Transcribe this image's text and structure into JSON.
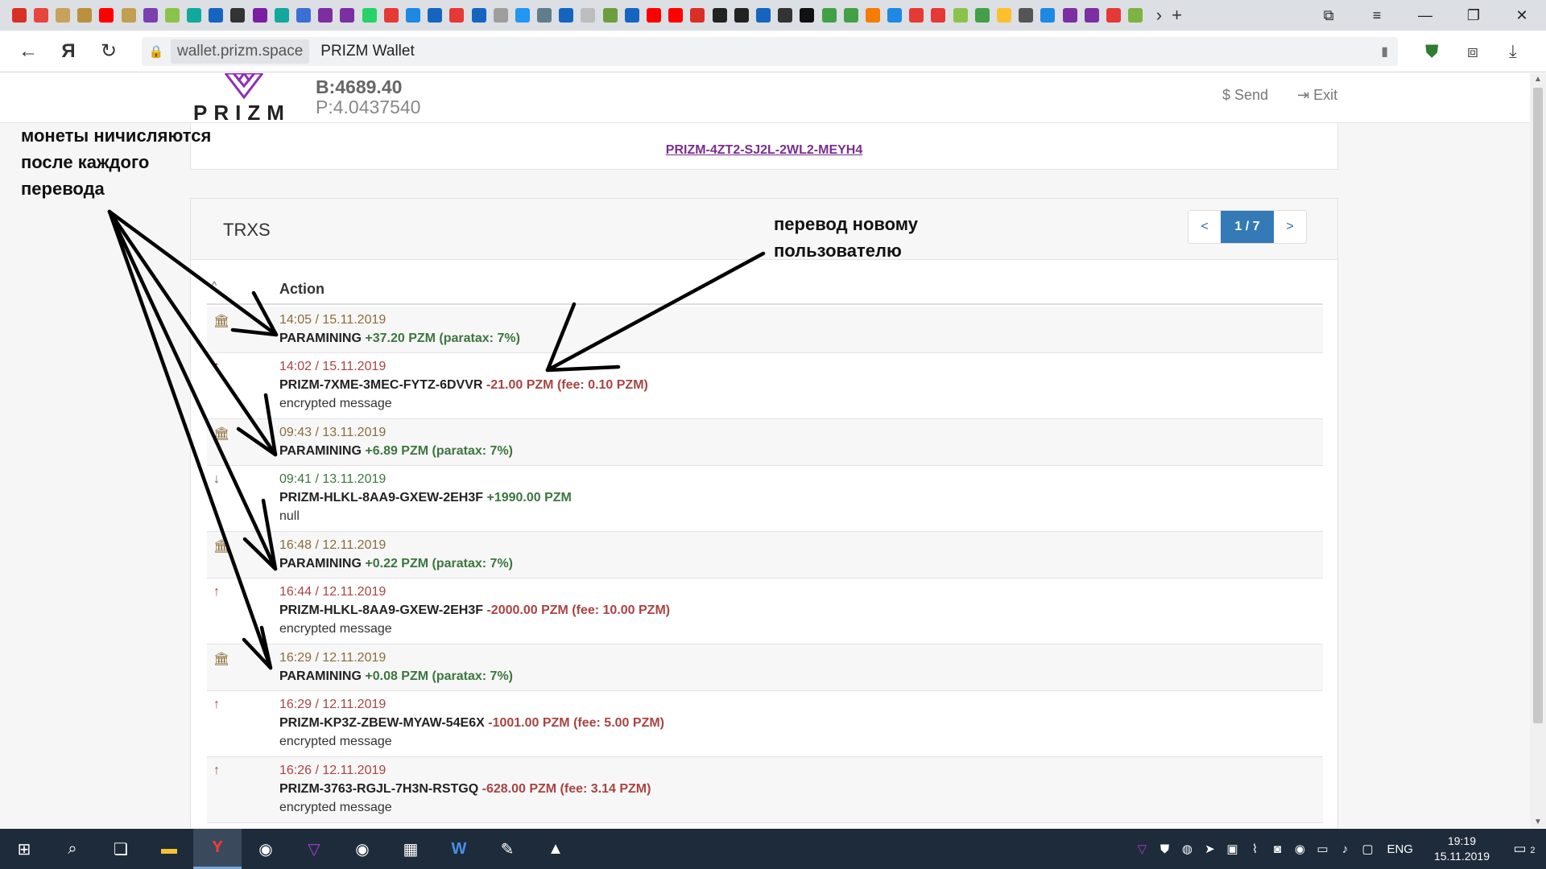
{
  "browser": {
    "domain": "wallet.prizm.space",
    "page_title": "PRIZM Wallet",
    "tab_icon_colors": [
      "#d93025",
      "#e8453c",
      "#c8a25c",
      "#b9913f",
      "#ff0000",
      "#c0a050",
      "#7b3fb0",
      "#8bc34a",
      "#13a89e",
      "#1565c0",
      "#333333",
      "#7b1fa2",
      "#13a89e",
      "#3b6fd6",
      "#7b2fa0",
      "#7b2fa0",
      "#25d366",
      "#e53935",
      "#1e88e5",
      "#1565c0",
      "#e53935",
      "#1565c0",
      "#9e9e9e",
      "#2196f3",
      "#607d8b",
      "#1565c0",
      "#bdbdbd",
      "#6d9e3d",
      "#1565c0",
      "#ff0000",
      "#ff0000",
      "#d93025",
      "#222222",
      "#222222",
      "#1565c0",
      "#333333",
      "#111111",
      "#43a047",
      "#43a047",
      "#f57c00",
      "#1e88e5",
      "#e53935",
      "#e53935",
      "#8bc34a",
      "#43a047",
      "#fbc02d",
      "#555555",
      "#1e88e5",
      "#7b2fa0",
      "#7b2fa0",
      "#e53935",
      "#7cb342"
    ]
  },
  "header": {
    "logo_text": "PRIZM",
    "balance_b": "B:4689.40",
    "balance_p": "P:4.0437540",
    "send_label": "Send",
    "exit_label": "Exit"
  },
  "account": {
    "address": "PRIZM-4ZT2-SJ2L-2WL2-MEYH4"
  },
  "trx": {
    "title": "TRXS",
    "pager": {
      "prev": "<",
      "current": "1 / 7",
      "next": ">"
    },
    "column": "Action",
    "rows": [
      {
        "icon": "bank",
        "date": "14:05 / 15.11.2019",
        "party": "PARAMINING",
        "amount": "+37.20 PZM (paratax: 7%)",
        "sign": "g",
        "msg": ""
      },
      {
        "icon": "up",
        "date": "14:02 / 15.11.2019",
        "party": "PRIZM-7XME-3MEC-FYTZ-6DVVR",
        "amount": "-21.00 PZM (fee: 0.10 PZM)",
        "sign": "r",
        "msg": "encrypted message"
      },
      {
        "icon": "bank",
        "date": "09:43 / 13.11.2019",
        "party": "PARAMINING",
        "amount": "+6.89 PZM (paratax: 7%)",
        "sign": "g",
        "msg": ""
      },
      {
        "icon": "down",
        "date": "09:41 / 13.11.2019",
        "party": "PRIZM-HLKL-8AA9-GXEW-2EH3F",
        "amount": "+1990.00 PZM",
        "sign": "g",
        "msg": "null"
      },
      {
        "icon": "bank",
        "date": "16:48 / 12.11.2019",
        "party": "PARAMINING",
        "amount": "+0.22 PZM (paratax: 7%)",
        "sign": "g",
        "msg": ""
      },
      {
        "icon": "up",
        "date": "16:44 / 12.11.2019",
        "party": "PRIZM-HLKL-8AA9-GXEW-2EH3F",
        "amount": "-2000.00 PZM (fee: 10.00 PZM)",
        "sign": "r",
        "msg": "encrypted message"
      },
      {
        "icon": "bank",
        "date": "16:29 / 12.11.2019",
        "party": "PARAMINING",
        "amount": "+0.08 PZM (paratax: 7%)",
        "sign": "g",
        "msg": ""
      },
      {
        "icon": "up",
        "date": "16:29 / 12.11.2019",
        "party": "PRIZM-KP3Z-ZBEW-MYAW-54E6X",
        "amount": "-1001.00 PZM (fee: 5.00 PZM)",
        "sign": "r",
        "msg": "encrypted message"
      },
      {
        "icon": "up",
        "date": "16:26 / 12.11.2019",
        "party": "PRIZM-3763-RGJL-7H3N-RSTGQ",
        "amount": "-628.00 PZM (fee: 3.14 PZM)",
        "sign": "r",
        "msg": "encrypted message"
      }
    ]
  },
  "annotations": {
    "left_note": "монеты ничисляются\nпосле каждого\nперевода",
    "right_note": "перевод новому\nпользователю"
  },
  "taskbar": {
    "language": "ENG",
    "time": "19:19",
    "date": "15.11.2019",
    "notifications": "2"
  }
}
